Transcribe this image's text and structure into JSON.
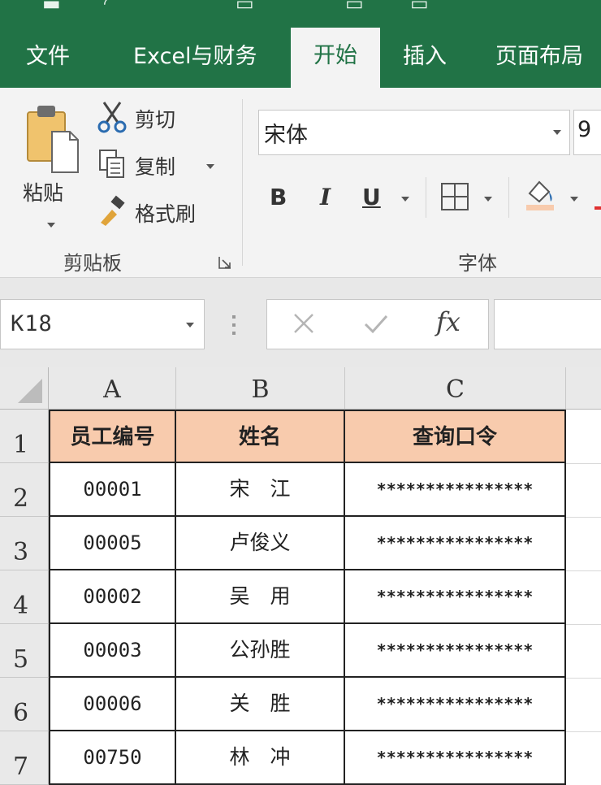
{
  "ribbon_tabs": [
    "文件",
    "Excel与财务",
    "开始",
    "插入",
    "页面布局"
  ],
  "active_tab": "开始",
  "clipboard": {
    "paste_label": "粘贴",
    "cut_label": "剪切",
    "copy_label": "复制",
    "format_painter_label": "格式刷",
    "group_label": "剪贴板"
  },
  "font": {
    "family_value": "宋体",
    "size_value": "9",
    "bold_label": "B",
    "italic_label": "I",
    "underline_label": "U",
    "group_label": "字体"
  },
  "formula_bar": {
    "name_box_value": "K18",
    "fx_label": "fx"
  },
  "sheet": {
    "columns": [
      "A",
      "B",
      "C"
    ],
    "row_numbers": [
      "1",
      "2",
      "3",
      "4",
      "5",
      "6",
      "7"
    ],
    "header_fill": "#f8cbad",
    "headers": [
      "员工编号",
      "姓名",
      "查询口令"
    ],
    "rows": [
      [
        "00001",
        "宋　江",
        "****************"
      ],
      [
        "00005",
        "卢俊义",
        "****************"
      ],
      [
        "00002",
        "吴　用",
        "****************"
      ],
      [
        "00003",
        "公孙胜",
        "****************"
      ],
      [
        "00006",
        "关　胜",
        "****************"
      ],
      [
        "00750",
        "林　冲",
        "****************"
      ]
    ]
  },
  "accent_color": "#217346"
}
